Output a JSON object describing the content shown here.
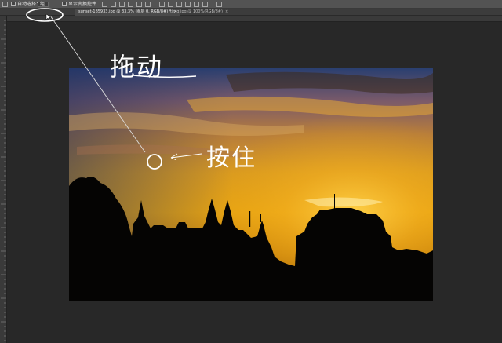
{
  "options_bar": {
    "auto_select_label": "自动选择：",
    "auto_select_value": "组",
    "show_transform_label": "显示变换控件"
  },
  "tabs": [
    {
      "label": "sunset-185933.jpg @ 33.3% (图层 0, RGB/8#) *",
      "close": "×"
    },
    {
      "label": "timg.jpg @ 100%(RGB/8#)",
      "close": "×"
    }
  ],
  "annotations": {
    "drag": "拖动",
    "hold": "按住"
  },
  "icons": {
    "move_tool": "move-tool-icon",
    "cursor": "cursor-arrow-icon"
  },
  "colors": {
    "annotation": "#ffffff",
    "ps_ui_dark": "#282828",
    "ps_ui_panel": "#535353"
  }
}
